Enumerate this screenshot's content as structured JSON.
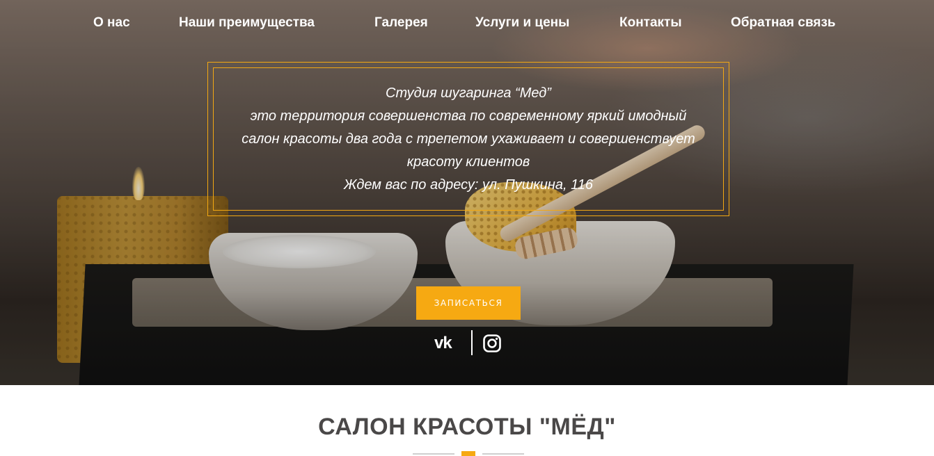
{
  "nav": {
    "items": [
      {
        "label": "О нас"
      },
      {
        "label": "Наши преимущества"
      },
      {
        "label": "Галерея"
      },
      {
        "label": "Услуги и цены"
      },
      {
        "label": "Контакты"
      },
      {
        "label": "Обратная связь"
      }
    ]
  },
  "hero": {
    "info_lines": [
      "Студия шугаринга “Мед”",
      "это территория совершенства по современному яркий имодный",
      "салон красоты два года с трепетом ухаживает и совершенствует",
      "красоту клиентов",
      "Ждем вас по адресу: ул. Пушкина, 116"
    ],
    "cta_label": "ЗАПИСАТЬСЯ",
    "social": {
      "vk_label": "vk",
      "vk_icon": "vk-icon",
      "instagram_icon": "instagram-icon"
    }
  },
  "section": {
    "title": "САЛОН КРАСОТЫ \"МЁД\""
  },
  "colors": {
    "accent": "#f6a912",
    "nav_text": "#ffffff",
    "title_text": "#4a4848"
  }
}
